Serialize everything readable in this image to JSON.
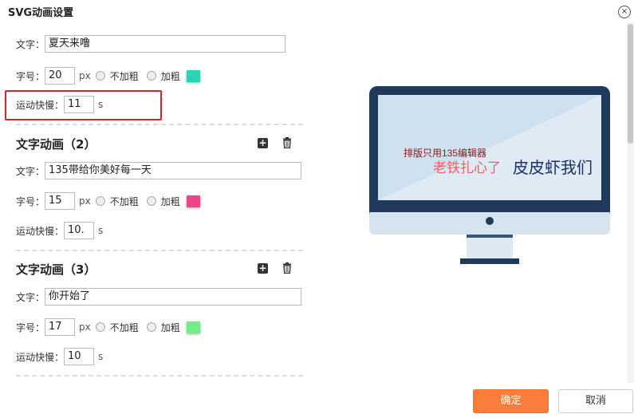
{
  "dialog": {
    "title": "SVG动画设置",
    "close_glyph": "×"
  },
  "labels": {
    "text": "文字：",
    "size": "字号：",
    "speed": "运动快慢：",
    "px": "px",
    "s": "s",
    "not_bold": "不加粗",
    "bold": "加粗"
  },
  "items": [
    {
      "text": "夏天来噜",
      "size": "20",
      "speed": "11",
      "color": "#2bd3b0"
    },
    {
      "title": "文字动画（2）",
      "text": "135带给你美好每一天",
      "size": "15",
      "speed": "10.",
      "color": "#f0448a"
    },
    {
      "title": "文字动画（3）",
      "text": "你开始了",
      "size": "17",
      "speed": "10",
      "color": "#6fef8a"
    }
  ],
  "preview": {
    "line1": "排版只用135编辑器",
    "line2": "老铁扎心了",
    "line3": "皮皮虾我们",
    "line1_color": "#8b1a1a",
    "line2_color": "#f06060",
    "line3_color": "#1a2f6b"
  },
  "footer": {
    "ok": "确定",
    "cancel": "取消"
  }
}
